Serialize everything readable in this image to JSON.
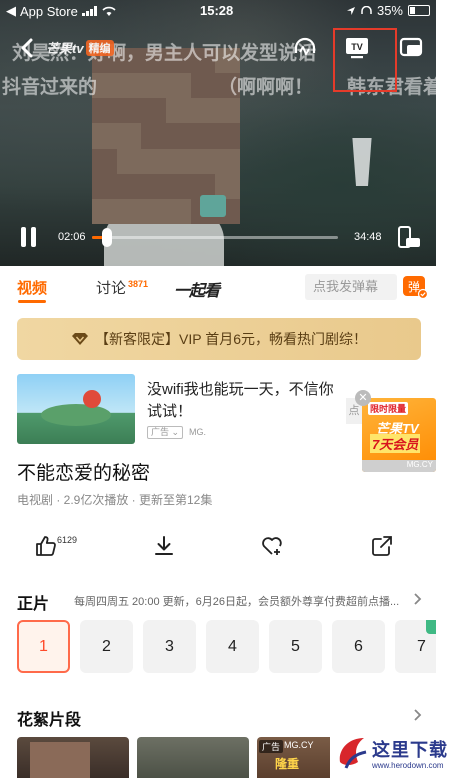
{
  "status_bar": {
    "carrier": "App Store",
    "time": "15:28",
    "battery": "35%",
    "battery_level": 0.35
  },
  "player": {
    "logo_text": "芒果tv",
    "logo_badge": "精编",
    "danmu": [
      "刘昊然：好啊，男主人可以发型说话",
      "抖音过来的",
      "（啊啊啊！",
      "韩东君看着"
    ],
    "current_time": "02:06",
    "total_time": "34:48",
    "progress": 0.06
  },
  "tabs": {
    "video": "视频",
    "discuss": "讨论",
    "discuss_count": "3871",
    "watch_together": "一起看",
    "danmu_placeholder": "点我发弹幕",
    "danmu_toggle": "弹"
  },
  "vip_banner": {
    "text": "【新客限定】VIP 首月6元，畅看热门剧综！"
  },
  "ad": {
    "title": "没wifi我也能玩一天，不信你试试！",
    "tag": "广告",
    "source": "MG.",
    "promo_top": "限时限量",
    "promo_line1": "芒果TV",
    "promo_line2": "7天会员",
    "promo_footer": "MG.CY",
    "promo_edge": "点"
  },
  "show": {
    "title": "不能恋爱的秘密",
    "meta": "电视剧 · 2.9亿次播放 · 更新至第12集",
    "like_count": "6129"
  },
  "episodes": {
    "heading": "正片",
    "note": "每周四周五 20:00 更新，6月26日起，会员额外尊享付费超前点播...",
    "items": [
      "1",
      "2",
      "3",
      "4",
      "5",
      "6",
      "7"
    ],
    "selected": "1"
  },
  "clips": {
    "heading": "花絮片段",
    "tag": "广告",
    "source": "MG.CY",
    "label": "隆重"
  },
  "watermark": {
    "title": "这里下载",
    "url": "www.herodown.com"
  },
  "colors": {
    "accent": "#ff6a00",
    "highlight": "#e53b2a",
    "vip_gold": "#e9c98c"
  },
  "icons": [
    "back-icon",
    "headphone-icon",
    "tv-cast-icon",
    "pip-icon",
    "pause-icon",
    "rotate-icon",
    "like-icon",
    "download-icon",
    "favorite-icon",
    "share-icon",
    "chevron-right-icon",
    "diamond-icon"
  ]
}
